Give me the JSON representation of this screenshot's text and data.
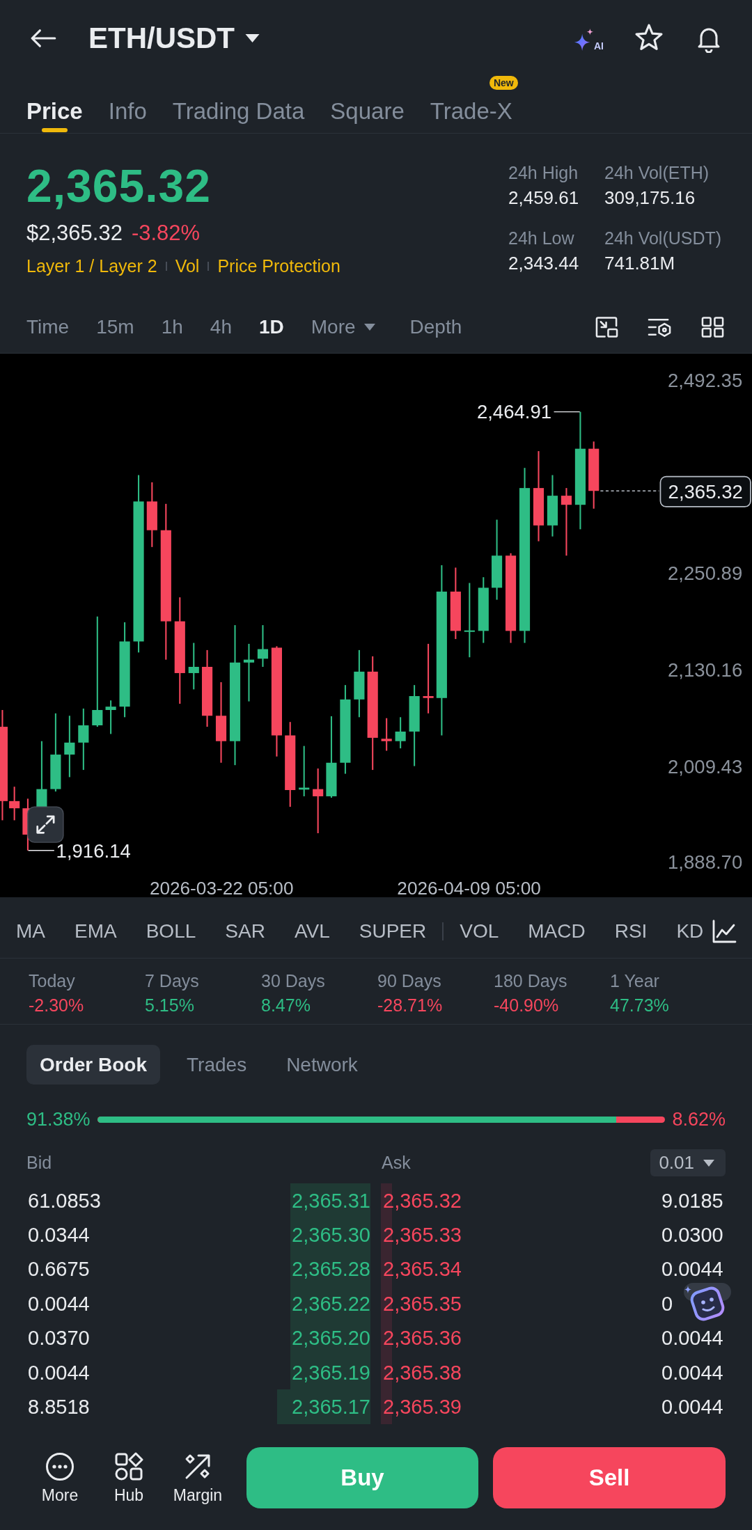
{
  "header": {
    "pair": "ETH/USDT",
    "ai_label": "AI"
  },
  "tabs": [
    {
      "label": "Price",
      "selected": true
    },
    {
      "label": "Info",
      "selected": false
    },
    {
      "label": "Trading Data",
      "selected": false
    },
    {
      "label": "Square",
      "selected": false
    },
    {
      "label": "Trade-X",
      "selected": false,
      "badge": "New"
    }
  ],
  "ticker": {
    "last_price": "2,365.32",
    "last_price_rising": true,
    "fiat_price": "$2,365.32",
    "change": "-3.82%",
    "change_negative": true,
    "tags": [
      "Layer 1 / Layer 2",
      "Vol",
      "Price Protection"
    ],
    "stats": [
      {
        "label": "24h High",
        "value": "2,459.61"
      },
      {
        "label": "24h Vol(ETH)",
        "value": "309,175.16"
      },
      {
        "label": "24h Low",
        "value": "2,343.44"
      },
      {
        "label": "24h Vol(USDT)",
        "value": "741.81M"
      }
    ]
  },
  "intervals": [
    {
      "label": "Time",
      "kind": "option",
      "selected": false
    },
    {
      "label": "15m",
      "kind": "option",
      "selected": false
    },
    {
      "label": "1h",
      "kind": "option",
      "selected": false
    },
    {
      "label": "4h",
      "kind": "option",
      "selected": false
    },
    {
      "label": "1D",
      "kind": "option",
      "selected": true
    },
    {
      "label": "More",
      "kind": "menu",
      "selected": false
    },
    {
      "label": "Depth",
      "kind": "view",
      "selected": false
    }
  ],
  "chart": {
    "y_labels": [
      "2,492.35",
      "2,250.89",
      "2,130.16",
      "2,009.43",
      "1,888.70"
    ],
    "x_labels": [
      "2026-03-22 05:00",
      "2026-04-09 05:00"
    ],
    "high_label": "2,464.91",
    "low_label": "1,916.14",
    "last_price_tag": "2,365.32"
  },
  "indicators": {
    "main": [
      "MA",
      "EMA",
      "BOLL",
      "SAR",
      "AVL",
      "SUPER"
    ],
    "sub": [
      "VOL",
      "MACD",
      "RSI",
      "KD"
    ]
  },
  "performance": [
    {
      "label": "Today",
      "value": "-2.30%",
      "negative": true
    },
    {
      "label": "7 Days",
      "value": "5.15%",
      "negative": false
    },
    {
      "label": "30 Days",
      "value": "8.47%",
      "negative": false
    },
    {
      "label": "90 Days",
      "value": "-28.71%",
      "negative": true
    },
    {
      "label": "180 Days",
      "value": "-40.90%",
      "negative": true
    },
    {
      "label": "1 Year",
      "value": "47.73%",
      "negative": false
    }
  ],
  "order_book": {
    "tabs": [
      {
        "label": "Order Book",
        "selected": true
      },
      {
        "label": "Trades",
        "selected": false
      },
      {
        "label": "Network",
        "selected": false
      }
    ],
    "ratio": {
      "bid_share": "91.38%",
      "ask_share": "8.62%",
      "level": 0.9138
    },
    "bid_header": "Bid",
    "ask_header": "Ask",
    "precision": "0.01",
    "rows": [
      {
        "bid_amount": "61.0853",
        "bid_price": "2,365.31",
        "ask_price": "2,365.32",
        "ask_amount": "9.0185",
        "bid_depth": {
          "level": 0.233
        },
        "ask_depth": {
          "level": 0.032
        }
      },
      {
        "bid_amount": "0.0344",
        "bid_price": "2,365.30",
        "ask_price": "2,365.33",
        "ask_amount": "0.0300",
        "bid_depth": {
          "level": 0.233
        },
        "ask_depth": {
          "level": 0.032
        }
      },
      {
        "bid_amount": "0.6675",
        "bid_price": "2,365.28",
        "ask_price": "2,365.34",
        "ask_amount": "0.0044",
        "bid_depth": {
          "level": 0.233
        },
        "ask_depth": {
          "level": 0.032
        }
      },
      {
        "bid_amount": "0.0044",
        "bid_price": "2,365.22",
        "ask_price": "2,365.35",
        "ask_amount": "0",
        "bid_depth": {
          "level": 0.233
        },
        "ask_depth": {
          "level": 0.032
        }
      },
      {
        "bid_amount": "0.0370",
        "bid_price": "2,365.20",
        "ask_price": "2,365.36",
        "ask_amount": "0.0044",
        "bid_depth": {
          "level": 0.233
        },
        "ask_depth": {
          "level": 0.032
        }
      },
      {
        "bid_amount": "0.0044",
        "bid_price": "2,365.19",
        "ask_price": "2,365.38",
        "ask_amount": "0.0044",
        "bid_depth": {
          "level": 0.233
        },
        "ask_depth": {
          "level": 0.032
        }
      },
      {
        "bid_amount": "8.8518",
        "bid_price": "2,365.17",
        "ask_price": "2,365.39",
        "ask_amount": "0.0044",
        "bid_depth": {
          "level": 0.271
        },
        "ask_depth": {
          "level": 0.032
        }
      }
    ]
  },
  "bottom_bar": {
    "items": [
      {
        "label": "More",
        "kind": "more"
      },
      {
        "label": "Hub",
        "kind": "hub"
      },
      {
        "label": "Margin",
        "kind": "margin"
      }
    ],
    "buy": "Buy",
    "sell": "Sell"
  }
}
